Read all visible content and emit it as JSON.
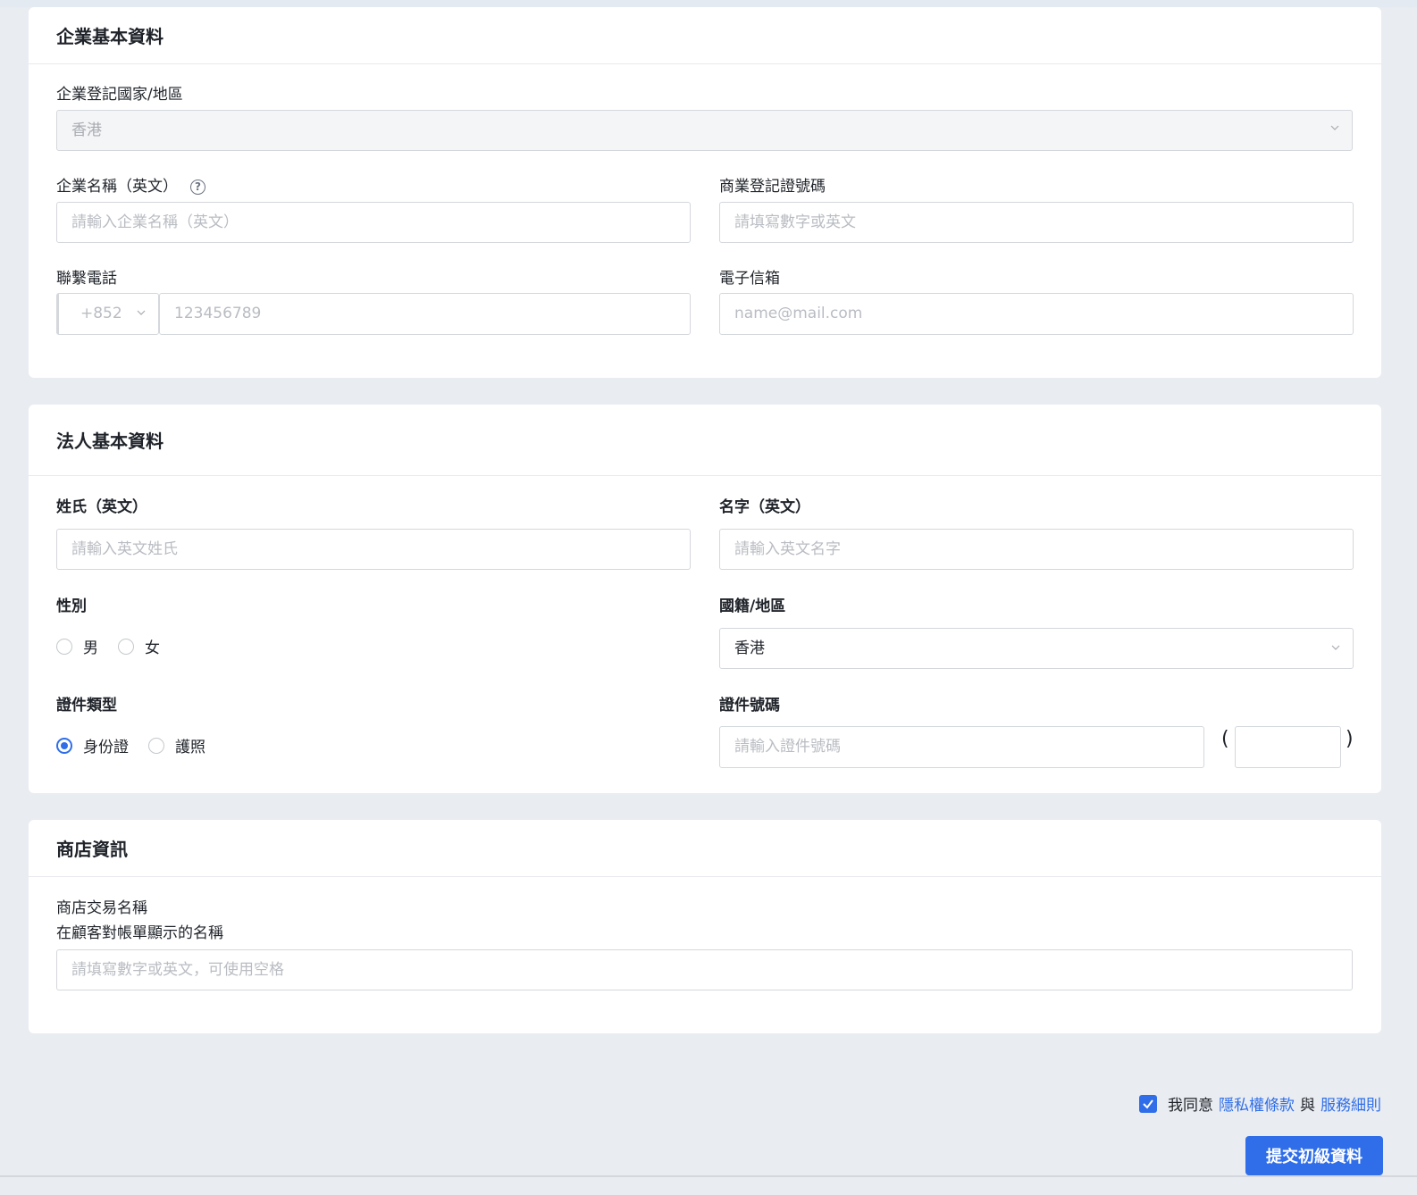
{
  "company": {
    "title": "企業基本資料",
    "country_label": "企業登記國家/地區",
    "country_value": "香港",
    "name_en_label": "企業名稱（英文）",
    "name_en_placeholder": "請輸入企業名稱（英文）",
    "br_label": "商業登記證號碼",
    "br_placeholder": "請填寫數字或英文",
    "phone_label": "聯繫電話",
    "phone_code": "+852",
    "phone_placeholder": "123456789",
    "email_label": "電子信箱",
    "email_placeholder": "name@mail.com"
  },
  "legal": {
    "title": "法人基本資料",
    "surname_label": "姓氏（英文）",
    "surname_placeholder": "請輸入英文姓氏",
    "given_label": "名字（英文）",
    "given_placeholder": "請輸入英文名字",
    "gender_label": "性別",
    "gender_options": [
      "男",
      "女"
    ],
    "nationality_label": "國籍/地區",
    "nationality_value": "香港",
    "id_type_label": "證件類型",
    "id_type_options": [
      "身份證",
      "護照"
    ],
    "id_type_selected": "身份證",
    "id_number_label": "證件號碼",
    "id_number_placeholder": "請輸入證件號碼",
    "paren_open": "(",
    "paren_close": ")"
  },
  "shop": {
    "title": "商店資訊",
    "name_label_line1": "商店交易名稱",
    "name_label_line2": "在顧客對帳單顯示的名稱",
    "name_placeholder": "請填寫數字或英文，可使用空格"
  },
  "footer": {
    "agree_prefix": "我同意",
    "privacy_link": "隱私權條款",
    "and": "與",
    "terms_link": "服務細則",
    "agree_checked": true,
    "submit_label": "提交初級資料"
  },
  "colors": {
    "accent": "#2f6ee8",
    "page_bg": "#e9ecf1",
    "card_bg": "#ffffff"
  }
}
